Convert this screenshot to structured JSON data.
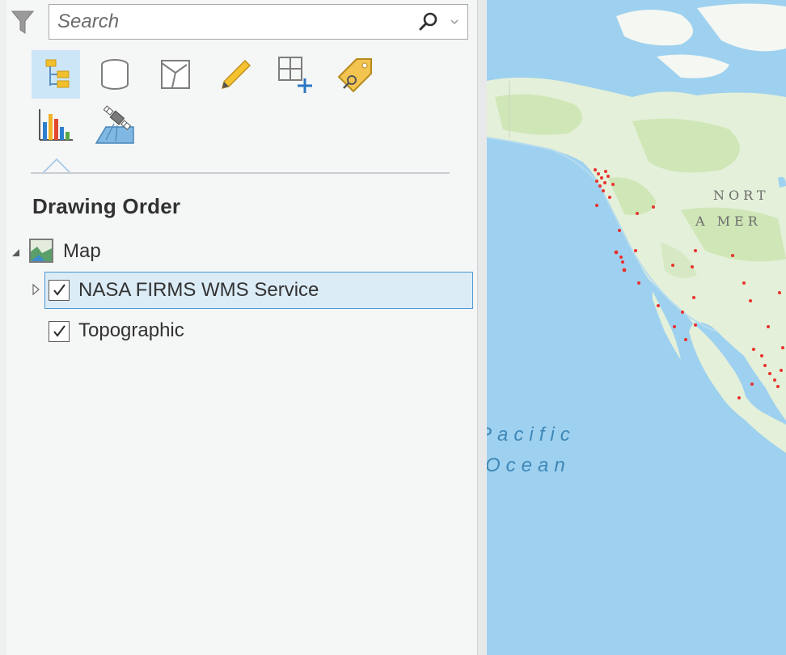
{
  "search": {
    "placeholder": "Search"
  },
  "toolbar": {
    "buttons": [
      {
        "icon": "list-by-drawing-order-icon",
        "active": true
      },
      {
        "icon": "list-by-data-source-icon"
      },
      {
        "icon": "list-by-selection-icon"
      },
      {
        "icon": "list-by-editing-icon"
      },
      {
        "icon": "list-by-snapping-icon"
      },
      {
        "icon": "list-by-labeling-icon"
      },
      {
        "icon": "list-by-charts-icon"
      },
      {
        "icon": "list-by-perspective-imagery-icon"
      }
    ]
  },
  "contents": {
    "section_title": "Drawing Order",
    "map": {
      "label": "Map",
      "expanded": true
    },
    "layers": [
      {
        "label": "NASA FIRMS WMS Service",
        "checked": true,
        "selected": true,
        "collapsed": true
      },
      {
        "label": "Topographic",
        "checked": true,
        "selected": false
      }
    ]
  },
  "map_view": {
    "labels": {
      "north": "NORT",
      "america": "A MER",
      "pacific": "Pacific",
      "ocean": "Ocean"
    },
    "colors": {
      "water": "#9ed1ef",
      "land": "#e4f0d9",
      "vegetation": "#cfe6b6",
      "fire": "#e8322f"
    }
  }
}
